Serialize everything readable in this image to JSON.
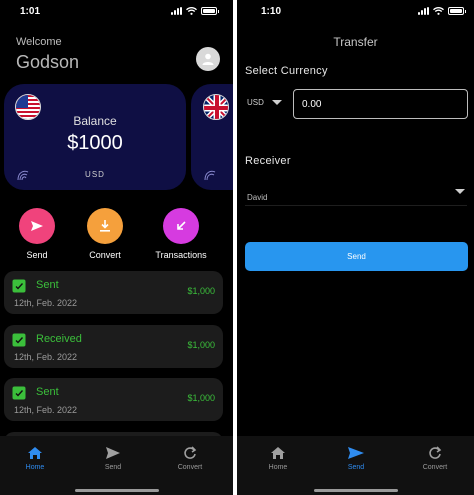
{
  "left_screen": {
    "status_time": "1:01",
    "welcome": "Welcome",
    "username": "Godson",
    "card": {
      "balance_label": "Balance",
      "amount": "$1000",
      "currency": "USD"
    },
    "actions": [
      {
        "label": "Send",
        "color": "#f0437c",
        "icon": "send-icon"
      },
      {
        "label": "Convert",
        "color": "#f5a03c",
        "icon": "download-icon"
      },
      {
        "label": "Transactions",
        "color": "#d63be0",
        "icon": "arrow-down-left-icon"
      }
    ],
    "transactions": [
      {
        "title": "Sent",
        "date": "12th, Feb. 2022",
        "amount": "$1,000"
      },
      {
        "title": "Received",
        "date": "12th, Feb. 2022",
        "amount": "$1,000"
      },
      {
        "title": "Sent",
        "date": "12th, Feb. 2022",
        "amount": "$1,000"
      }
    ],
    "nav": [
      {
        "label": "Home",
        "icon": "home-icon",
        "active": true
      },
      {
        "label": "Send",
        "icon": "send-icon",
        "active": false
      },
      {
        "label": "Convert",
        "icon": "refresh-icon",
        "active": false
      }
    ]
  },
  "right_screen": {
    "status_time": "1:10",
    "title": "Transfer",
    "select_currency_label": "Select Currency",
    "currency_code": "USD",
    "amount_value": "0.00",
    "receiver_label": "Receiver",
    "receiver_name": "David",
    "send_button": "Send",
    "nav": [
      {
        "label": "Home",
        "icon": "home-icon",
        "active": false
      },
      {
        "label": "Send",
        "icon": "send-icon",
        "active": true
      },
      {
        "label": "Convert",
        "icon": "refresh-icon",
        "active": false
      }
    ]
  },
  "colors": {
    "accent_blue": "#2896ef",
    "positive_green": "#3bbf3b",
    "card_bg": "#0f0f44",
    "tile_bg": "#1c1c1c"
  }
}
